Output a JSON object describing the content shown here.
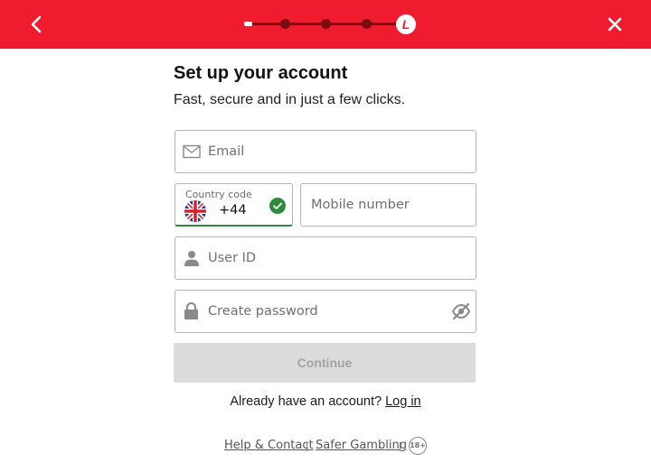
{
  "header": {
    "back_icon": "chevron-left-icon",
    "close_icon": "close-icon",
    "progress_steps": 5,
    "progress_current": 1,
    "logo_letter": "L",
    "colors": {
      "brand": "#ee1c2e",
      "track": "#7a0c14"
    }
  },
  "form": {
    "title": "Set up your account",
    "subtitle": "Fast, secure and in just a few clicks.",
    "email": {
      "placeholder": "Email",
      "icon": "envelope-icon"
    },
    "country": {
      "label": "Country code",
      "value": "+44",
      "flag": "uk-flag-icon",
      "status_icon": "check-circle-icon",
      "status_color": "#2e8b3d"
    },
    "mobile": {
      "placeholder": "Mobile number"
    },
    "user_id": {
      "placeholder": "User ID",
      "icon": "user-icon"
    },
    "password": {
      "placeholder": "Create password",
      "icon": "lock-icon",
      "toggle_icon": "eye-off-icon"
    },
    "continue_label": "Continue"
  },
  "login": {
    "prompt": "Already have an account?",
    "link": "Log in"
  },
  "footer": {
    "help": "Help & Contact",
    "safer": "Safer Gambling",
    "age": "18+"
  }
}
